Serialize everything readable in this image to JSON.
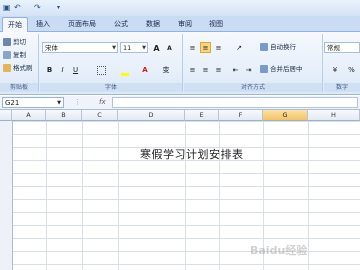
{
  "quick_access": {
    "icons": [
      "save-icon",
      "undo-icon",
      "redo-icon",
      "customize-icon"
    ]
  },
  "tabs": [
    {
      "label": "开始",
      "active": true
    },
    {
      "label": "插入",
      "active": false
    },
    {
      "label": "页面布局",
      "active": false
    },
    {
      "label": "公式",
      "active": false
    },
    {
      "label": "数据",
      "active": false
    },
    {
      "label": "审阅",
      "active": false
    },
    {
      "label": "视图",
      "active": false
    }
  ],
  "clipboard": {
    "cut": "剪切",
    "copy": "复制",
    "format_painter": "格式刷",
    "group_label": "剪贴板"
  },
  "font": {
    "name": "宋体",
    "size": "11",
    "grow": "A",
    "shrink": "A",
    "bold": "B",
    "italic": "I",
    "underline": "U",
    "font_color_letter": "A",
    "phonetic": "变",
    "group_label": "字体"
  },
  "alignment": {
    "wrap_text": "自动换行",
    "merge_center": "合并后居中",
    "group_label": "对齐方式"
  },
  "number": {
    "format": "常规",
    "percent": "%",
    "group_label": "数字"
  },
  "formula_bar": {
    "cell_ref": "G21",
    "fx": "fx",
    "value": ""
  },
  "columns": [
    "A",
    "B",
    "C",
    "D",
    "E",
    "F",
    "G",
    "H"
  ],
  "selected_column": "G",
  "cells": {
    "title": "寒假学习计划安排表"
  },
  "watermark": "Baidu经验",
  "colors": {
    "accent": "#f5c35f",
    "ribbon": "#dde9f8",
    "font_color": "#d01818",
    "highlight": "#ffff00"
  }
}
